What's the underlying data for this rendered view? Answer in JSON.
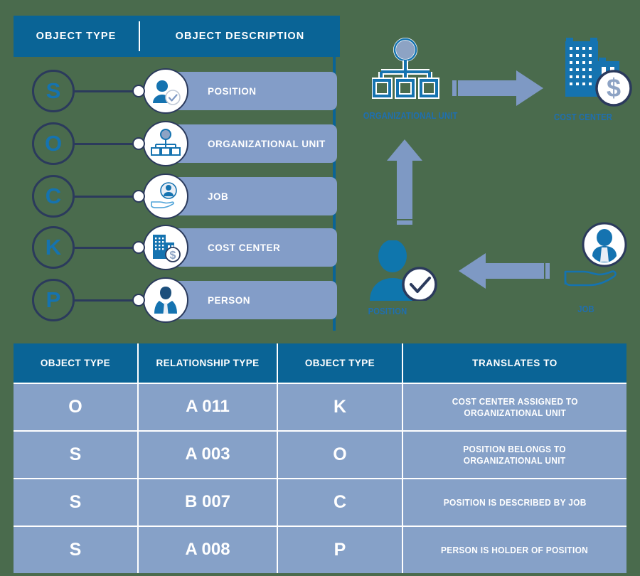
{
  "legend": {
    "headers": [
      "OBJECT TYPE",
      "OBJECT DESCRIPTION"
    ],
    "items": [
      {
        "code": "S",
        "label": "POSITION",
        "icon": "position-icon"
      },
      {
        "code": "O",
        "label": "ORGANIZATIONAL UNIT",
        "icon": "org-unit-icon"
      },
      {
        "code": "C",
        "label": "JOB",
        "icon": "job-icon"
      },
      {
        "code": "K",
        "label": "COST CENTER",
        "icon": "cost-center-icon"
      },
      {
        "code": "P",
        "label": "PERSON",
        "icon": "person-icon"
      }
    ]
  },
  "diagram": {
    "nodes": [
      {
        "id": "org-unit",
        "label": "ORGANIZATIONAL UNIT",
        "icon": "org-unit-icon"
      },
      {
        "id": "cost-center",
        "label": "COST CENTER",
        "icon": "cost-center-icon"
      },
      {
        "id": "position",
        "label": "POSITION",
        "icon": "position-icon"
      },
      {
        "id": "job",
        "label": "JOB",
        "icon": "job-icon"
      }
    ],
    "arrows": [
      {
        "id": "org-unit-to-cost-center",
        "direction": "right"
      },
      {
        "id": "position-to-org-unit",
        "direction": "up"
      },
      {
        "id": "job-to-position",
        "direction": "left"
      }
    ]
  },
  "table": {
    "headers": [
      "OBJECT TYPE",
      "RELATIONSHIP TYPE",
      "OBJECT TYPE",
      "TRANSLATES TO"
    ],
    "rows": [
      {
        "object_type_1": "O",
        "relationship_type": "A 011",
        "object_type_2": "K",
        "translates_to_line1": "COST CENTER ASSIGNED TO",
        "translates_to_line2": "ORGANIZATIONAL UNIT"
      },
      {
        "object_type_1": "S",
        "relationship_type": "A 003",
        "object_type_2": "O",
        "translates_to_line1": "POSITION BELONGS TO",
        "translates_to_line2": "ORGANIZATIONAL UNIT"
      },
      {
        "object_type_1": "S",
        "relationship_type": "B 007",
        "object_type_2": "C",
        "translates_to_line1": "POSITION IS DESCRIBED BY JOB",
        "translates_to_line2": ""
      },
      {
        "object_type_1": "S",
        "relationship_type": "A 008",
        "object_type_2": "P",
        "translates_to_line1": "PERSON IS HOLDER OF POSITION",
        "translates_to_line2": ""
      }
    ]
  },
  "colors": {
    "background": "#4a6b4d",
    "header_blue": "#0a6496",
    "row_blue": "#86a1c8",
    "pill_blue": "#839dc8",
    "navy": "#2b3a5c",
    "icon_blue": "#1573b0",
    "arrow_blue": "#7e99c4",
    "label_blue": "#1f6fb0",
    "white": "#ffffff"
  }
}
